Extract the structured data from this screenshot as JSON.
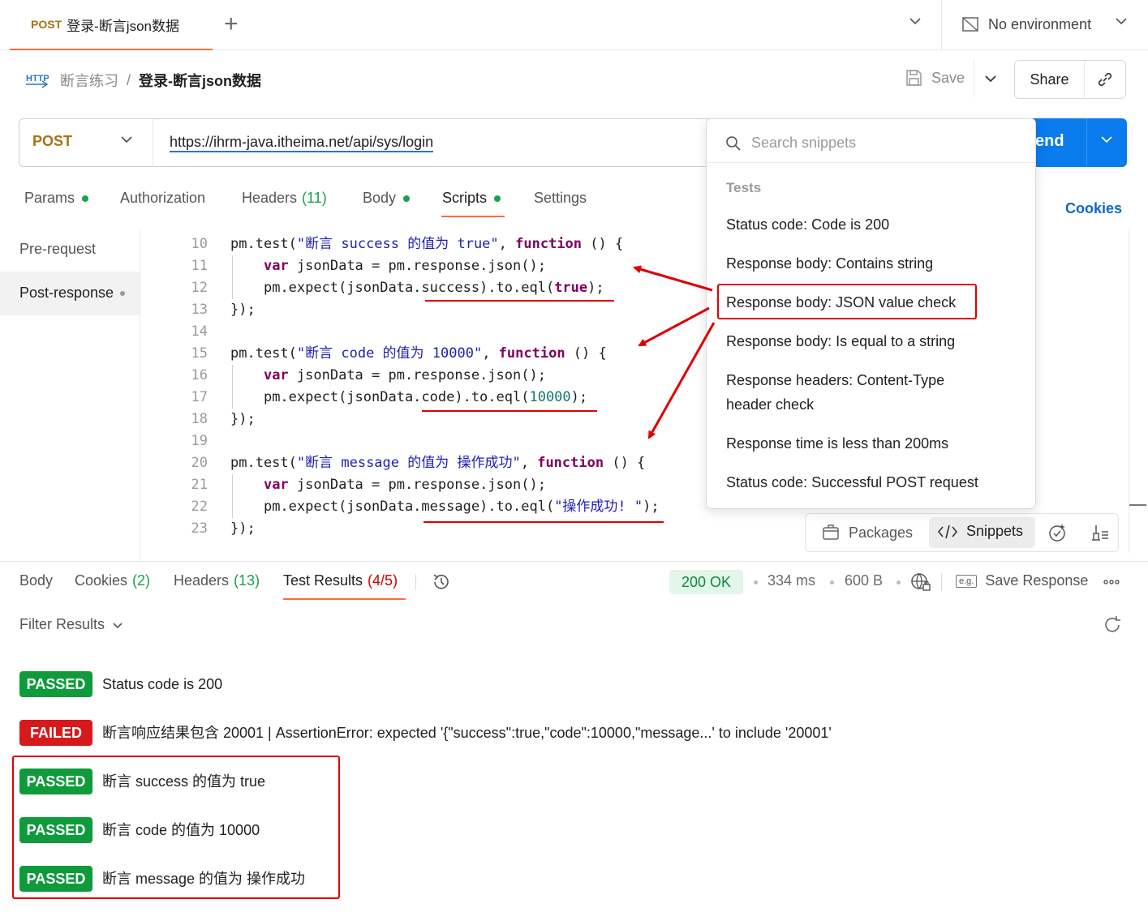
{
  "tab": {
    "method": "POST",
    "title": "登录-断言json数据"
  },
  "environment": {
    "label": "No environment"
  },
  "breadcrumb": {
    "parent": "断言练习",
    "separator": "/",
    "current": "登录-断言json数据"
  },
  "header_actions": {
    "save_label": "Save",
    "share_label": "Share"
  },
  "request": {
    "method": "POST",
    "url": "https://ihrm-java.itheima.net/api/sys/login",
    "send_label": "end"
  },
  "request_tabs": {
    "params": "Params",
    "authorization": "Authorization",
    "headers": "Headers",
    "headers_count": "(11)",
    "body": "Body",
    "scripts": "Scripts",
    "settings": "Settings",
    "cookies": "Cookies"
  },
  "script_tabs": {
    "pre": "Pre-request",
    "post": "Post-response"
  },
  "code": {
    "line_numbers": [
      "10",
      "11",
      "12",
      "13",
      "14",
      "15",
      "16",
      "17",
      "18",
      "19",
      "20",
      "21",
      "22",
      "23"
    ],
    "t1_open": "pm.test(",
    "t1_str": "\"断言 success 的值为 true\"",
    "t1_mid": ", ",
    "function_kw": "function",
    "t1_end": " () {",
    "indent": "    ",
    "var_kw": "var",
    "var_rest": " jsonData = pm.response.json();",
    "e1_a": "pm.expect(jsonData.success).to.eql(",
    "e1_v": "true",
    "e_close": ");",
    "close": "});",
    "t2_str": "\"断言 code 的值为 10000\"",
    "e2_a": "pm.expect(jsonData.code).to.eql(",
    "e2_v": "10000",
    "t3_str": "\"断言 message 的值为 操作成功\"",
    "e3_a": "pm.expect(jsonData.message).to.eql(",
    "e3_v": "\"操作成功! \""
  },
  "snippets": {
    "search_placeholder": "Search snippets",
    "heading": "Tests",
    "items": [
      "Status code: Code is 200",
      "Response body: Contains string",
      "Response body: JSON value check",
      "Response body: Is equal to a string",
      "Response headers: Content-Type header check",
      "Response time is less than 200ms",
      "Status code: Successful POST request"
    ]
  },
  "editor_toolbar": {
    "packages": "Packages",
    "snippets": "Snippets"
  },
  "response": {
    "tabs": {
      "body": "Body",
      "cookies": "Cookies",
      "cookies_count": "(2)",
      "headers": "Headers",
      "headers_count": "(13)",
      "test_results": "Test Results",
      "test_results_count": "(4/5)"
    },
    "status": "200 OK",
    "time": "334 ms",
    "size": "600 B",
    "save_response": "Save Response",
    "save_icon_text": "e.g.",
    "filter": "Filter Results"
  },
  "results": [
    {
      "status": "PASSED",
      "text": "Status code is 200"
    },
    {
      "status": "FAILED",
      "text": "断言响应结果包含 20001 | AssertionError: expected '{\"success\":true,\"code\":10000,\"message...' to include '20001'"
    },
    {
      "status": "PASSED",
      "text": "断言 success 的值为 true"
    },
    {
      "status": "PASSED",
      "text": "断言 code 的值为 10000"
    },
    {
      "status": "PASSED",
      "text": "断言 message 的值为 操作成功"
    }
  ],
  "colors": {
    "accent": "#ff6c37",
    "send": "#097bed",
    "pass": "#0f9a3c",
    "fail": "#d7191c",
    "annotation": "#e00000"
  }
}
